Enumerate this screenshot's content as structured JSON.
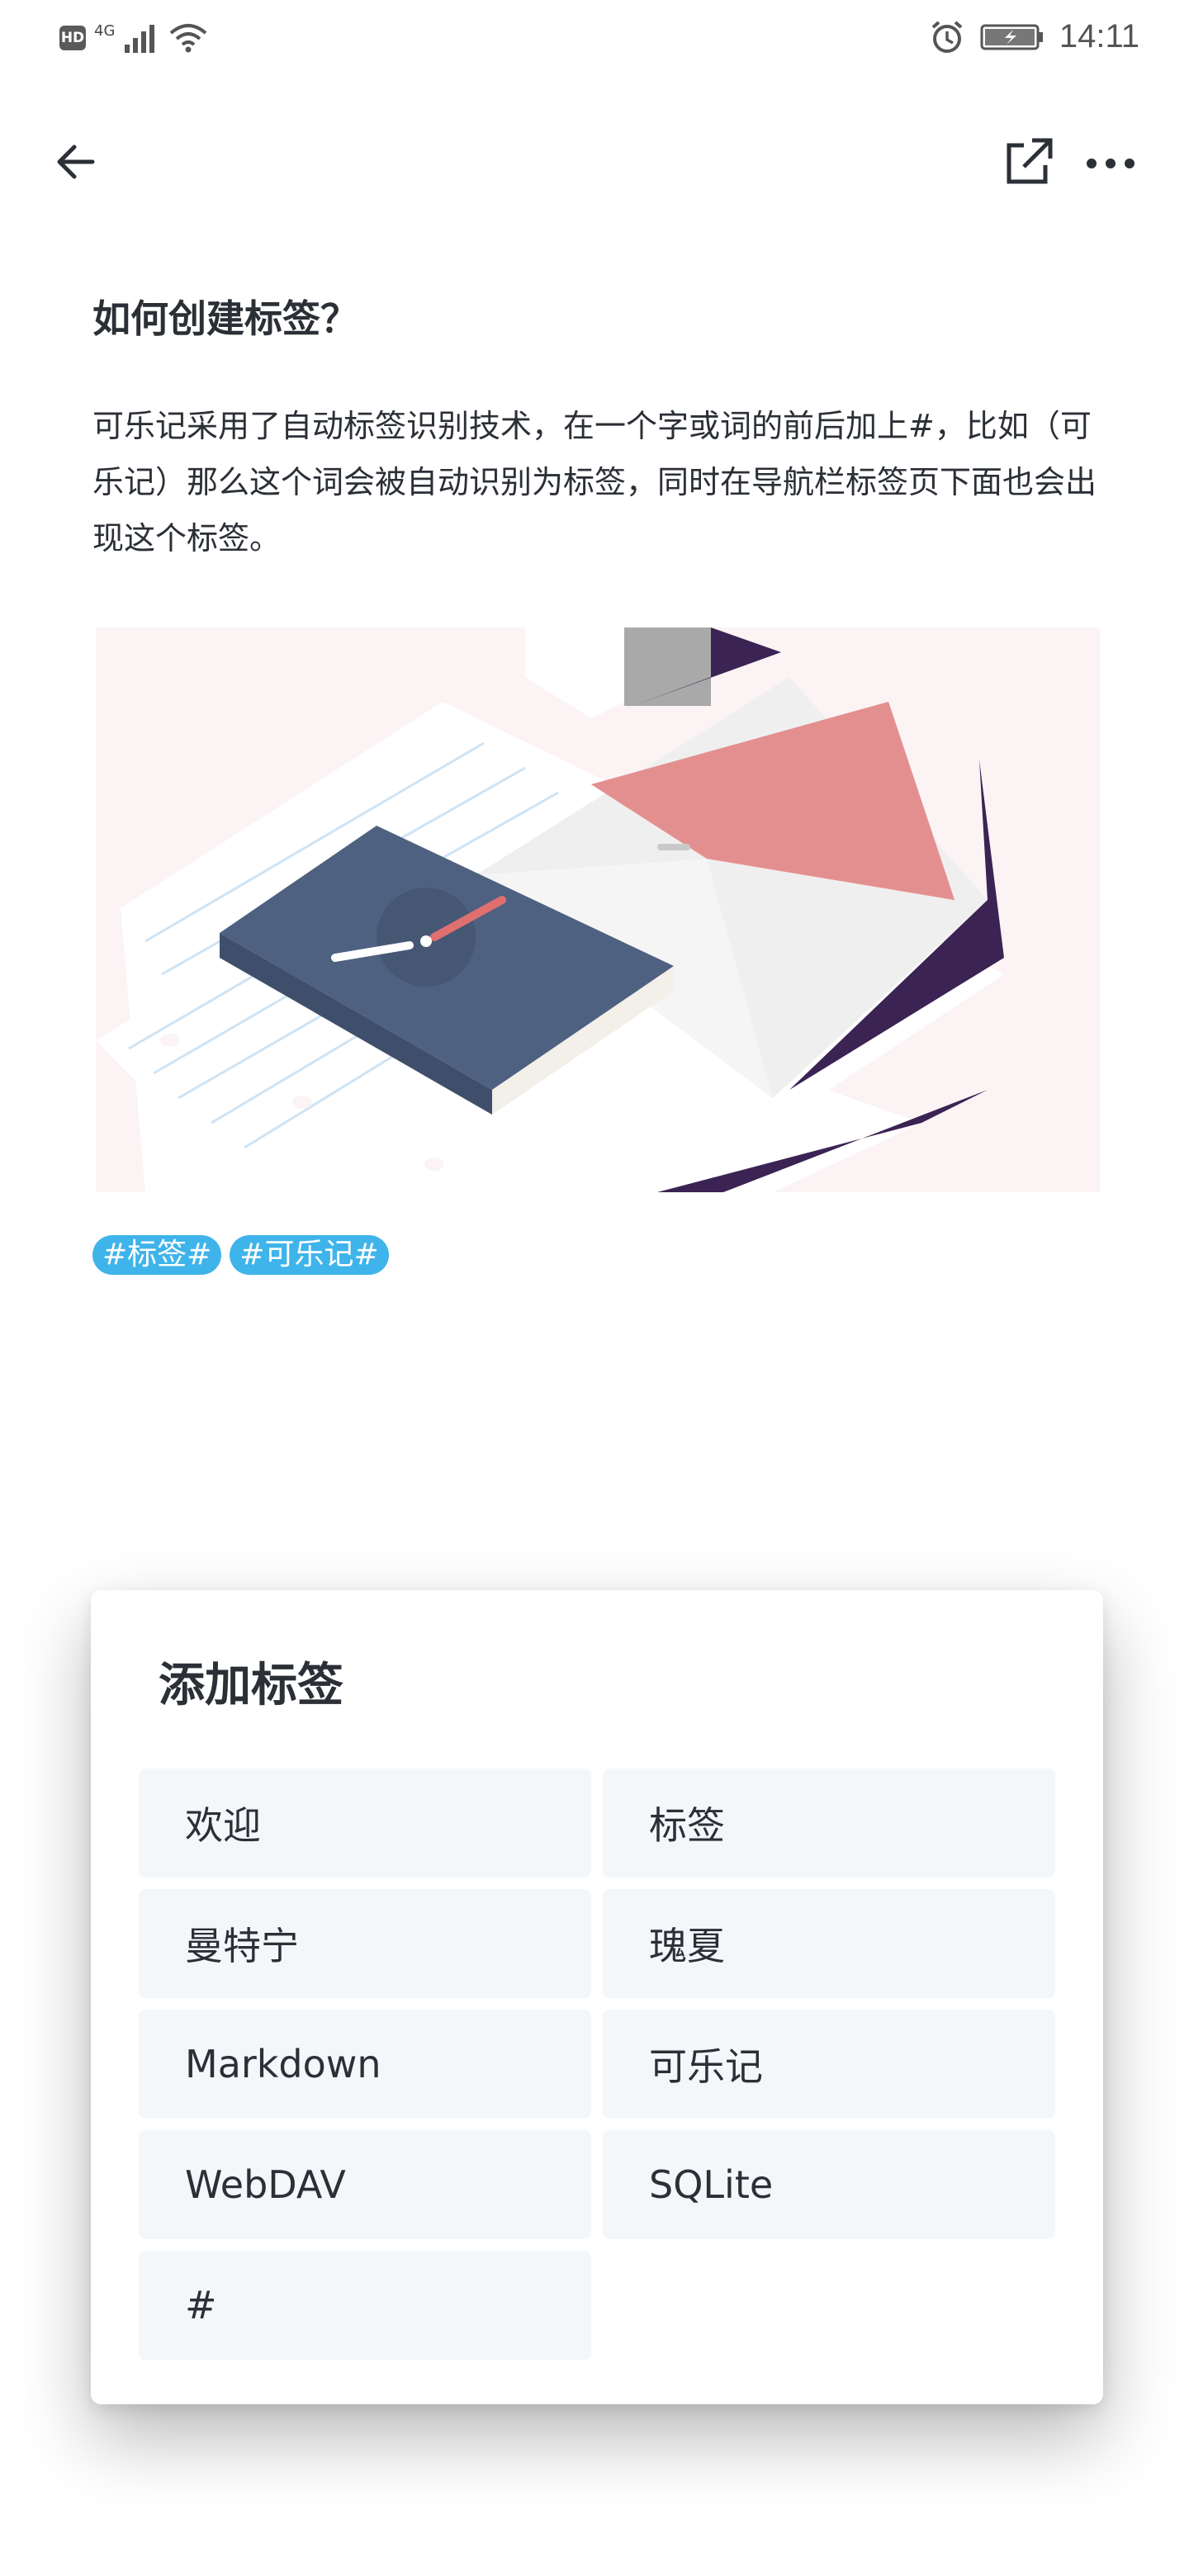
{
  "status_bar": {
    "hd_badge": "HD",
    "network": "4G",
    "time": "14:11",
    "icons": [
      "signal-icon",
      "wifi-icon",
      "alarm-icon",
      "battery-charging-icon"
    ]
  },
  "toolbar": {
    "icons": [
      "back-arrow-icon",
      "share-icon",
      "more-icon"
    ]
  },
  "note": {
    "title": "如何创建标签？",
    "paragraph": "可乐记采用了自动标签识别技术，在一个字或词的前后加上#，比如（可乐记）那么这个词会被自动识别为标签，同时在导航栏标签页下面也会出现这个标签。",
    "tags": [
      "#标签#",
      "#可乐记#"
    ]
  },
  "dialog": {
    "title": "添加标签",
    "options": [
      "欢迎",
      "标签",
      "曼特宁",
      "瑰夏",
      "Markdown",
      "可乐记",
      "WebDAV",
      "SQLite",
      "#"
    ]
  },
  "colors": {
    "accent": "#3fb4ea",
    "option_bg": "#f4f7fa",
    "text": "#2b2f36",
    "illustration_bg": "#fcf3f5"
  }
}
